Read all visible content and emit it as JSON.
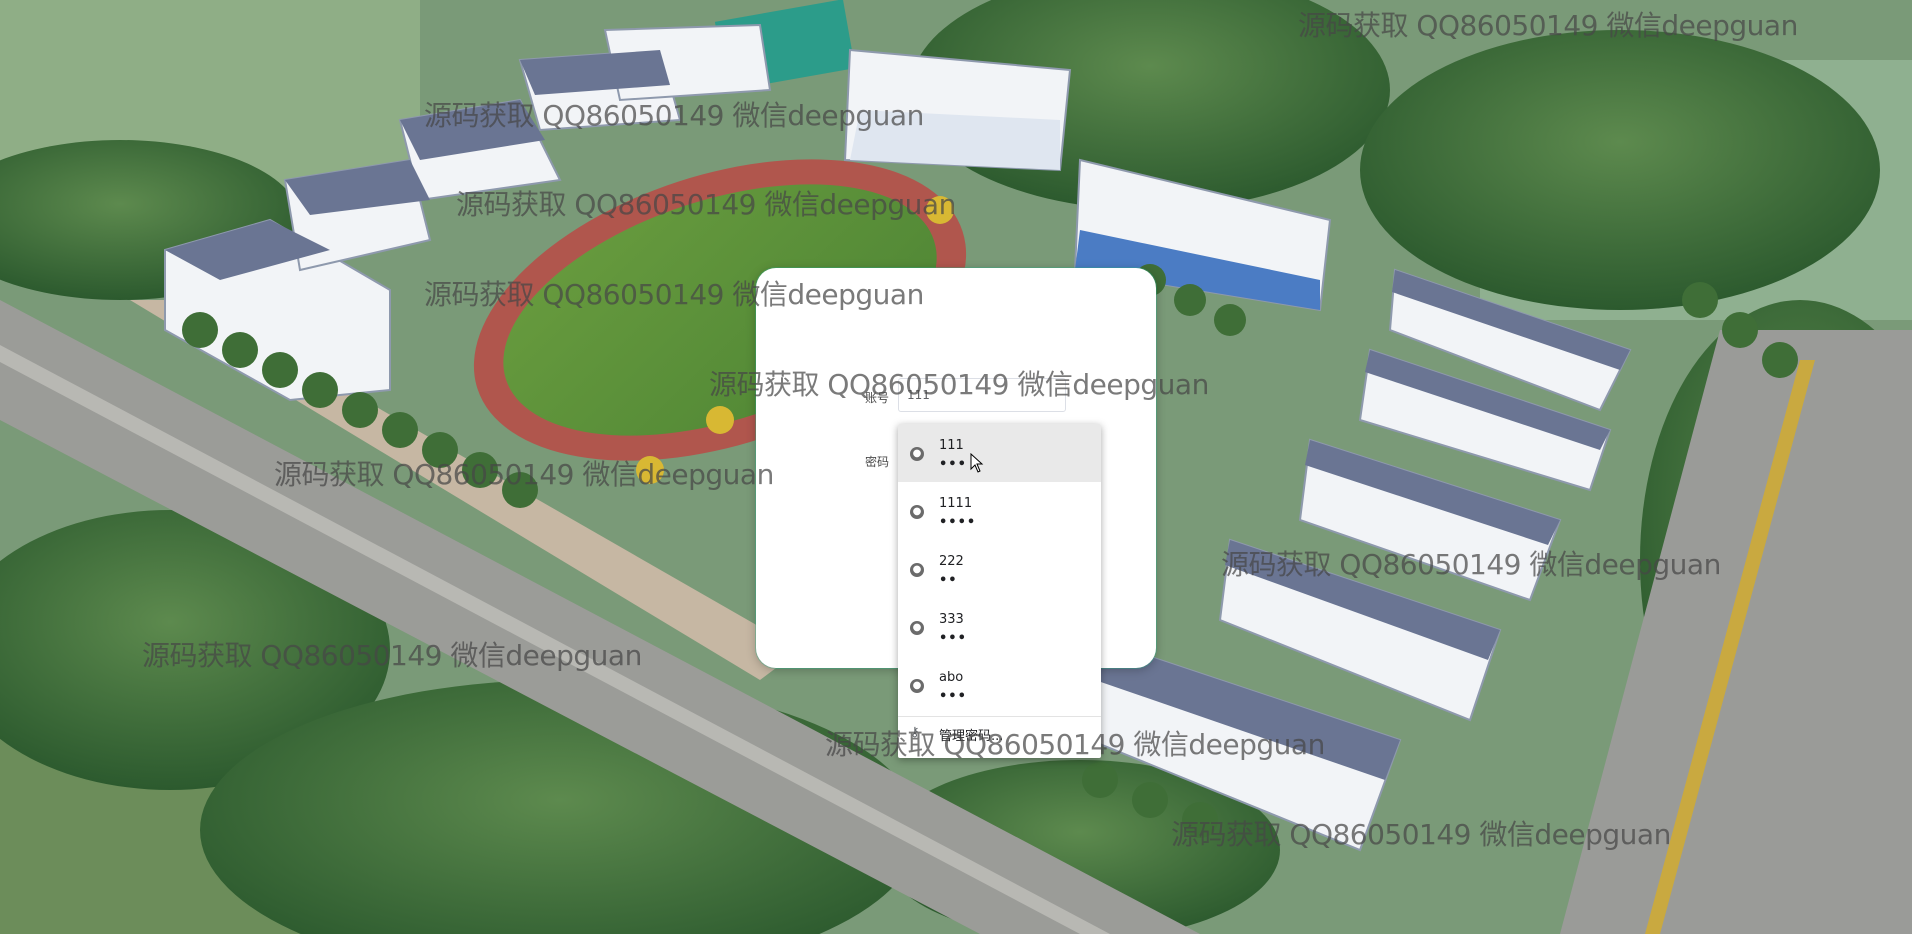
{
  "form": {
    "account_label": "账号",
    "account_value": "111",
    "password_label": "密码"
  },
  "autofill": {
    "items": [
      {
        "username": "111",
        "masked_password": "•••"
      },
      {
        "username": "1111",
        "masked_password": "••••"
      },
      {
        "username": "222",
        "masked_password": "••"
      },
      {
        "username": "333",
        "masked_password": "•••"
      },
      {
        "username": "abo",
        "masked_password": "•••"
      }
    ],
    "manage_label": "管理密码..."
  },
  "watermark": {
    "text": "源码获取 QQ86050149 微信deepguan"
  },
  "icons": {
    "entry_icon": "globe-icon",
    "manage_icon": "key-icon",
    "cursor": "mouse-pointer-icon"
  },
  "colors": {
    "card_bg": "#ffffff",
    "card_border_accent": "#28b48c",
    "dropdown_active": "#e9e9e9",
    "watermark": "#464646"
  }
}
